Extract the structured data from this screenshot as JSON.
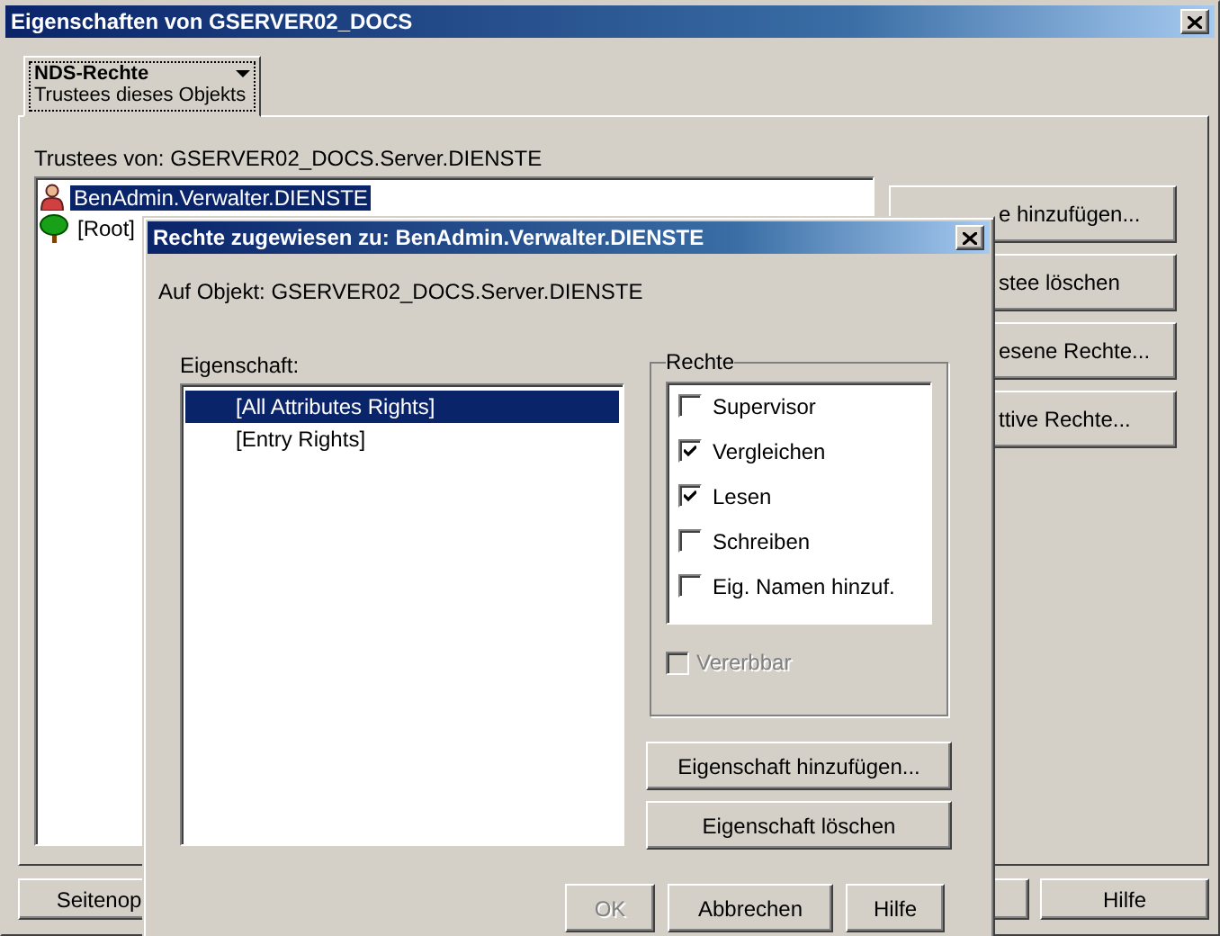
{
  "window": {
    "title": "Eigenschaften von GSERVER02_DOCS"
  },
  "tabs": [
    {
      "label": "NDS-Rechte",
      "sublabel": "Trustees dieses Objekts",
      "selected": true
    }
  ],
  "trustees_label": "Trustees von: GSERVER02_DOCS.Server.DIENSTE",
  "trustees": [
    {
      "kind": "user",
      "label": "BenAdmin.Verwalter.DIENSTE",
      "selected": true
    },
    {
      "kind": "tree",
      "label": "[Root]",
      "selected": false
    }
  ],
  "side_buttons": [
    "e hinzufügen...",
    "stee löschen",
    "esene Rechte...",
    "ttive Rechte..."
  ],
  "bottom_buttons": [
    "Seitenop",
    "Hilfe"
  ],
  "dialog": {
    "title": "Rechte zugewiesen zu: BenAdmin.Verwalter.DIENSTE",
    "object_label": "Auf Objekt: GSERVER02_DOCS.Server.DIENSTE",
    "property_label": "Eigenschaft:",
    "properties": [
      {
        "label": "[All Attributes Rights]",
        "selected": true
      },
      {
        "label": "[Entry Rights]",
        "selected": false
      }
    ],
    "rights_title": "Rechte",
    "rights": [
      {
        "label": "Supervisor",
        "checked": false
      },
      {
        "label": "Vergleichen",
        "checked": true
      },
      {
        "label": "Lesen",
        "checked": true
      },
      {
        "label": "Schreiben",
        "checked": false
      },
      {
        "label": "Eig. Namen hinzuf.",
        "checked": false
      }
    ],
    "inheritable": {
      "label": "Vererbbar",
      "checked": false,
      "disabled": true
    },
    "property_buttons": [
      "Eigenschaft hinzufügen...",
      "Eigenschaft löschen"
    ],
    "buttons": [
      {
        "label": "OK",
        "disabled": true
      },
      {
        "label": "Abbrechen",
        "disabled": false
      },
      {
        "label": "Hilfe",
        "disabled": false
      }
    ]
  }
}
